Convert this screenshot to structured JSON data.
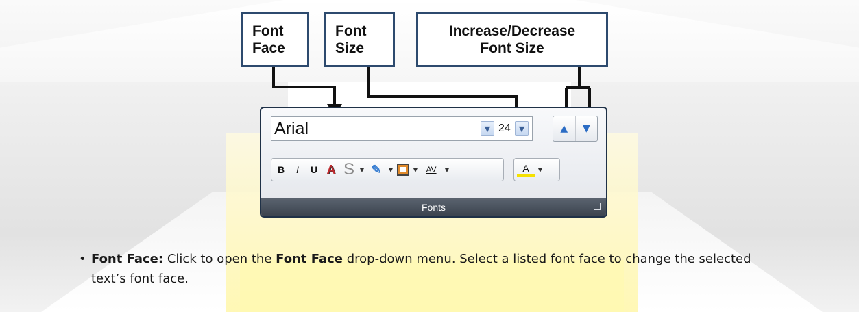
{
  "callouts": {
    "font_face": {
      "line1": "Font",
      "line2": "Face"
    },
    "font_size": {
      "line1": "Font",
      "line2": "Size"
    },
    "inc_dec": {
      "line1": "Increase/Decrease",
      "line2": "Font Size"
    }
  },
  "ribbon": {
    "font_face_value": "Arial",
    "font_size_value": "24",
    "dropdown_icon": "chevron-down-icon",
    "increase_icon": "arrow-up-icon",
    "decrease_icon": "arrow-down-icon",
    "format_buttons": {
      "bold": "B",
      "italic": "I",
      "underline": "U",
      "shadow": "A",
      "strikethrough": "S",
      "char_spacing": "AV",
      "highlight": "A"
    },
    "group_label": "Fonts"
  },
  "description": {
    "bullet": "•",
    "term": "Font Face:",
    "text_part1": " Click to open the ",
    "term_inline": "Font Face",
    "text_part2": " drop-down menu. Select a listed font face to change the selected text’s font face."
  },
  "colors": {
    "callout_border": "#2d4a6e",
    "ribbon_footer": "#3b434e",
    "highlight_yellow": "#fff6a8"
  }
}
